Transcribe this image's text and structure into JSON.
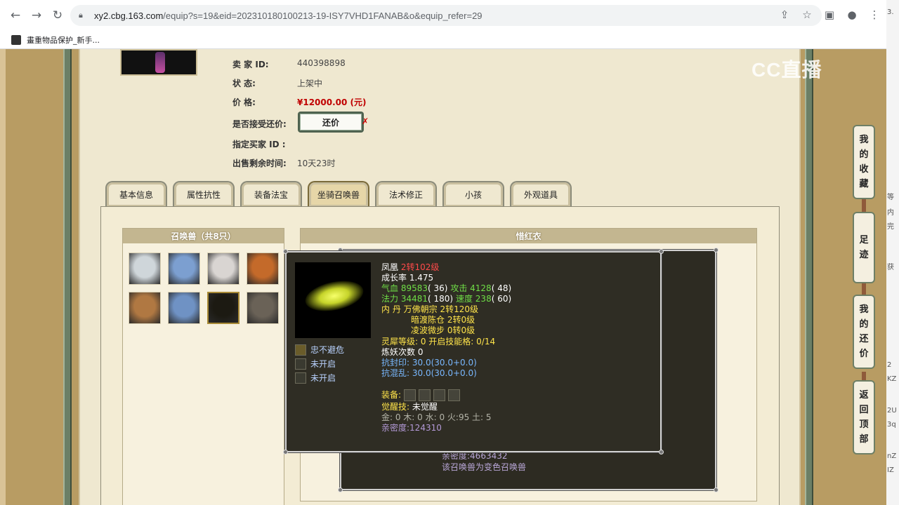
{
  "browser": {
    "url_host": "xy2.cbg.163.com",
    "url_path": "/equip?s=19&eid=202310180100213-19-ISY7VHD1FANAB&o&equip_refer=29",
    "bookmark": "畫重物品保护_新手..."
  },
  "watermark": "CC直播",
  "side_strip": [
    "3.",
    "等",
    "内",
    "完",
    "获",
    "2",
    "KZ",
    "2U",
    "3q",
    "nZ",
    "IZ"
  ],
  "seller": {
    "id_label": "卖  家  ID:",
    "id_value": "440398898",
    "status_label": "状        态:",
    "status_value": "上架中",
    "price_label": "价        格:",
    "price_value": "¥12000.00 (元)",
    "bargain_label": "是否接受还价:",
    "bargain_button": "还价",
    "bargain_mark": "✗",
    "buyer_label": "指定买家 ID :",
    "remaining_label": "出售剩余时间:",
    "remaining_value": "10天23时"
  },
  "tabs": [
    "基本信息",
    "属性抗性",
    "装备法宝",
    "坐骑召唤兽",
    "法术修正",
    "小孩",
    "外观道具"
  ],
  "active_tab": 3,
  "pets_header": "召唤兽（共8只）",
  "pets": [
    {
      "name": "polar-bear",
      "color": "#cfd6da"
    },
    {
      "name": "ice-spirit",
      "color": "#7c9fd0"
    },
    {
      "name": "white-fox-lady",
      "color": "#d9d5d2"
    },
    {
      "name": "fire-beast",
      "color": "#c46a2a"
    },
    {
      "name": "princess",
      "color": "#b07842"
    },
    {
      "name": "ice-spirit-2",
      "color": "#6f92c4"
    },
    {
      "name": "phoenix",
      "color": "#1c1a12"
    },
    {
      "name": "wolf",
      "color": "#6a6257"
    }
  ],
  "right_header": "惜红衣",
  "under_panel": {
    "line1": "亲密度:4663432",
    "line2": "该召唤兽为变色召唤兽"
  },
  "tooltip": {
    "name": "凤凰",
    "level": "2转102级",
    "growth": "成长率 1.475",
    "hp_label": "气血",
    "hp": "89583",
    "hp_pts": "( 36)",
    "atk_label": "攻击",
    "atk": "4128",
    "atk_pts": "( 48)",
    "mp_label": "法力",
    "mp": "34481",
    "mp_pts": "( 180)",
    "spd_label": "速度",
    "spd": "238",
    "spd_pts": "( 60)",
    "dan_label": "内    丹",
    "dan1": "万佛朝宗 2转120级",
    "dan2": "暗渡陈仓 2转0级",
    "dan3": "凌波微步 0转0级",
    "spirit": "灵犀等级:  0 开启技能格:  0/14",
    "refine": "炼妖次数 0",
    "seal": "抗封印: 30.0(30.0+0.0)",
    "chaos": "抗混乱: 30.0(30.0+0.0)",
    "equip_label": "装备:",
    "awaken_label": "觉醒技:",
    "awaken_value": "未觉醒",
    "elements": "金: 0 木: 0 水: 0 火:95 土: 5",
    "intimacy": "亲密度:124310",
    "skills": [
      "忠不避危",
      "未开启",
      "未开启"
    ]
  },
  "side_buttons": [
    [
      "我",
      "的",
      "收",
      "藏"
    ],
    [
      "足",
      "迹"
    ],
    [
      "我",
      "的",
      "还",
      "价"
    ],
    [
      "返",
      "回",
      "顶",
      "部"
    ]
  ]
}
